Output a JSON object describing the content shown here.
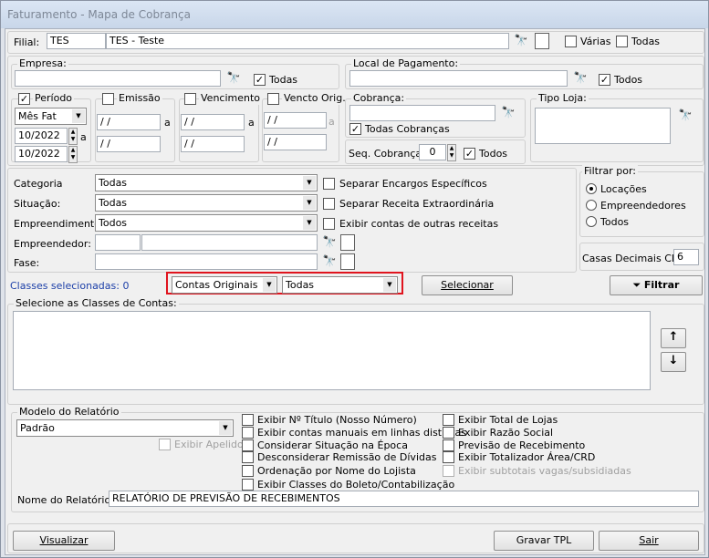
{
  "window": {
    "title": "Faturamento - Mapa de Cobrança"
  },
  "filial": {
    "label": "Filial:",
    "code": "TES",
    "name": "TES - Teste",
    "varias": "Várias",
    "todas": "Todas"
  },
  "empresa": {
    "legend": "Empresa:",
    "todas": "Todas"
  },
  "local": {
    "legend": "Local de Pagamento:",
    "todos": "Todos"
  },
  "periodo": {
    "legend": "Período",
    "combo": "Mês Fat",
    "from": "10/2022",
    "to": "10/2022",
    "a": "a"
  },
  "emissao": {
    "legend": "Emissão",
    "from": "/ /",
    "to": "/ /",
    "a": "a"
  },
  "vencimento": {
    "legend": "Vencimento",
    "from": "/ /",
    "to": "/ /",
    "a": "a"
  },
  "vencto_orig": {
    "legend": "Vencto Orig.",
    "from": "/ /",
    "to": "/ /",
    "a": "a"
  },
  "cobranca": {
    "legend": "Cobrança:",
    "todas": "Todas Cobranças",
    "seq_label": "Seq. Cobrança:",
    "seq_value": "0",
    "todos": "Todos"
  },
  "tipo_loja": {
    "legend": "Tipo Loja:"
  },
  "filters": {
    "categoria_label": "Categoria",
    "categoria": "Todas",
    "situacao_label": "Situação:",
    "situacao": "Todas",
    "empreendimento_label": "Empreendimento:",
    "empreendimento": "Todos",
    "empreendedor_label": "Empreendedor:",
    "fase_label": "Fase:"
  },
  "options": {
    "separar_encargos": "Separar Encargos Específicos",
    "separar_receita": "Separar Receita Extraordinária",
    "exibir_outras": "Exibir contas de outras receitas"
  },
  "filtrar_por": {
    "legend": "Filtrar por:",
    "options": [
      "Locações",
      "Empreendedores",
      "Todos"
    ],
    "selected": "Locações"
  },
  "casas": {
    "label": "Casas Decimais CRD",
    "value": "6"
  },
  "classes": {
    "count_label": "Classes selecionadas: 0",
    "combo1": "Contas Originais",
    "combo2": "Todas",
    "selecionar": "Selecionar",
    "filtrar": "Filtrar",
    "list_legend": "Selecione as Classes de Contas:",
    "up": "↑",
    "down": "↓"
  },
  "modelo": {
    "legend": "Modelo do Relatório",
    "combo": "Padrão",
    "exibir_apelido": "Exibir Apelido",
    "nome_label": "Nome do Relatório:",
    "nome_value": "RELATÓRIO DE PREVISÃO DE RECEBIMENTOS"
  },
  "report_opts_left": [
    "Exibir Nº Título (Nosso Número)",
    "Exibir contas manuais em linhas distintas",
    "Considerar Situação na Época",
    "Desconsiderar Remissão de Dívidas",
    "Ordenação por Nome do Lojista",
    "Exibir Classes do Boleto/Contabilização"
  ],
  "report_opts_right": [
    "Exibir Total de Lojas",
    "Exibir Razão Social",
    "Previsão de Recebimento",
    "Exibir Totalizador Área/CRD",
    "Exibir subtotais vagas/subsidiadas"
  ],
  "footer": {
    "visualizar": "Visualizar",
    "gravar": "Gravar TPL",
    "sair": "Sair"
  },
  "highlight_color": "#e0141e"
}
